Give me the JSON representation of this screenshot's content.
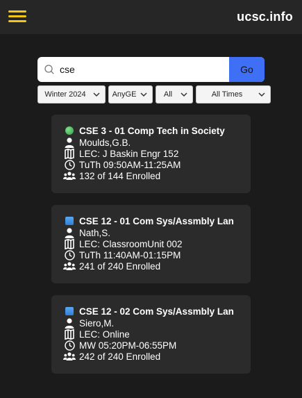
{
  "header": {
    "brand": "ucsc.info",
    "accent_color": "#f5c518",
    "menu_icon": "hamburger-menu-icon"
  },
  "search": {
    "value": "cse",
    "placeholder": "",
    "go_label": "Go",
    "go_color": "#3f6ff5"
  },
  "filters": {
    "term": "Winter 2024",
    "ge": "AnyGE",
    "status": "All",
    "times": "All Times"
  },
  "courses": [
    {
      "status_icon": "green-circle-icon",
      "status_color": "#3fb950",
      "title": "CSE 3 - 01 Comp Tech in Society",
      "instructor": "Moulds,G.B.",
      "location": "LEC: J Baskin Engr 152",
      "time": "TuTh 09:50AM-11:25AM",
      "enrollment": "132 of 144 Enrolled"
    },
    {
      "status_icon": "blue-square-icon",
      "status_color": "#3d8ee6",
      "title": "CSE 12 - 01 Com Sys/Assmbly Lan",
      "instructor": "Nath,S.",
      "location": "LEC: ClassroomUnit 002",
      "time": "TuTh 11:40AM-01:15PM",
      "enrollment": "241 of 240 Enrolled"
    },
    {
      "status_icon": "blue-square-icon",
      "status_color": "#3d8ee6",
      "title": "CSE 12 - 02 Com Sys/Assmbly Lan",
      "instructor": "Siero,M.",
      "location": "LEC: Online",
      "time": "MW 05:20PM-06:55PM",
      "enrollment": "242 of 240 Enrolled"
    }
  ]
}
